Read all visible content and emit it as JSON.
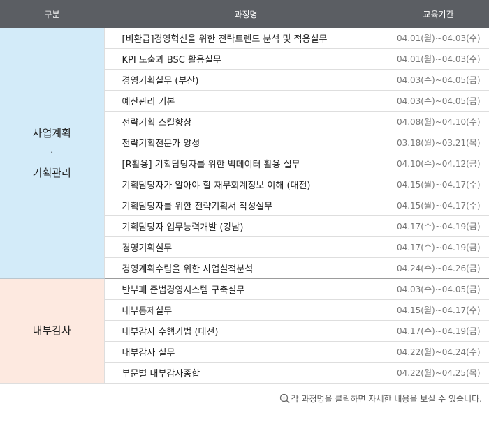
{
  "header": {
    "category": "구분",
    "course_name": "과정명",
    "period": "교육기간"
  },
  "groups": [
    {
      "category_line1": "사업계획",
      "category_dot": "·",
      "category_line2": "기획관리",
      "color": "#d3ebf9",
      "courses": [
        {
          "name": "[비환급]경영혁신을 위한 전략트렌드 분석 및 적용실무",
          "period": "04.01(월)~04.03(수)"
        },
        {
          "name": "KPI 도출과 BSC 활용실무",
          "period": "04.01(월)~04.03(수)"
        },
        {
          "name": "경영기획실무 (부산)",
          "period": "04.03(수)~04.05(금)"
        },
        {
          "name": "예산관리 기본",
          "period": "04.03(수)~04.05(금)"
        },
        {
          "name": "전략기획 스킬향상",
          "period": "04.08(월)~04.10(수)"
        },
        {
          "name": "전략기획전문가 양성",
          "period": "03.18(월)~03.21(목)"
        },
        {
          "name": "[R활용] 기획담당자를 위한 빅데이터 활용 실무",
          "period": "04.10(수)~04.12(금)"
        },
        {
          "name": "기획담당자가 알아야 할 재무회계정보 이해 (대전)",
          "period": "04.15(월)~04.17(수)"
        },
        {
          "name": "기획담당자를 위한 전략기획서 작성실무",
          "period": "04.15(월)~04.17(수)"
        },
        {
          "name": "기획담당자 업무능력개발 (강남)",
          "period": "04.17(수)~04.19(금)"
        },
        {
          "name": "경영기획실무",
          "period": "04.17(수)~04.19(금)"
        },
        {
          "name": "경영계획수립을 위한 사업실적분석",
          "period": "04.24(수)~04.26(금)"
        }
      ]
    },
    {
      "category_line1": "내부감사",
      "color": "#fde9e0",
      "courses": [
        {
          "name": "반부패 준법경영시스템 구축실무",
          "period": "04.03(수)~04.05(금)"
        },
        {
          "name": "내부통제실무",
          "period": "04.15(월)~04.17(수)"
        },
        {
          "name": "내부감사 수행기법 (대전)",
          "period": "04.17(수)~04.19(금)"
        },
        {
          "name": "내부감사 실무",
          "period": "04.22(월)~04.24(수)"
        },
        {
          "name": "부문별 내부감사종합",
          "period": "04.22(월)~04.25(목)"
        }
      ]
    }
  ],
  "notice": "각 과정명을 클릭하면 자세한 내용을 보실 수 있습니다.",
  "notice_icon": "zoom-in-icon"
}
